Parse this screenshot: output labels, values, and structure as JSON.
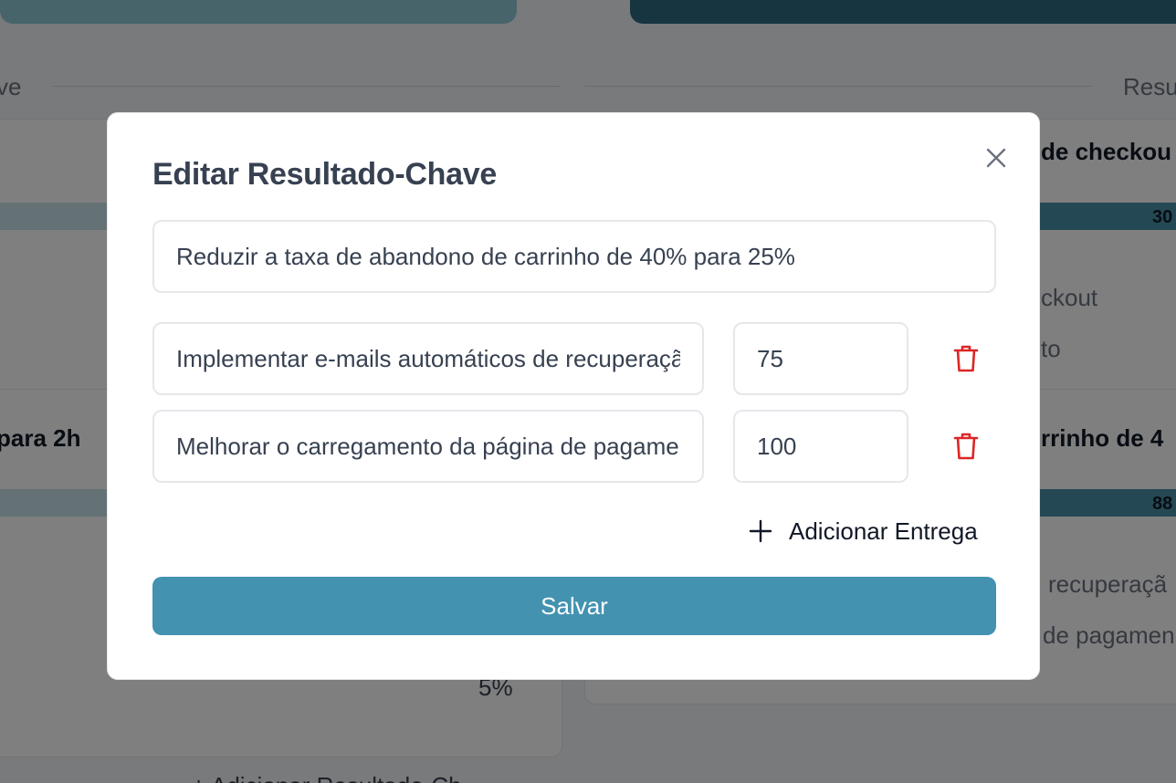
{
  "background": {
    "left_header_fragment": "ve",
    "right_header_fragment": "Resu",
    "left_kr_title_fragment": "para 2h",
    "left_pct_fragment": "5%",
    "left_add_fragment": "+ Adicionar Resultado-Ch",
    "right_kr1_title_fragment": "de checkou",
    "right_kr1_pct_fragment": "30",
    "right_kr1_item1_fragment": "ckout",
    "right_kr1_item2_fragment": "to",
    "right_kr2_title_fragment": "rrinho de 4",
    "right_kr2_pct_fragment": "88",
    "right_kr2_item1_fragment": "recuperaçã",
    "right_kr2_item2_fragment": "de pagamen"
  },
  "modal": {
    "title": "Editar Resultado-Chave",
    "key_result_value": "Reduzir a taxa de abandono de carrinho de 40% para 25%",
    "deliverables": [
      {
        "name": "Implementar e-mails automáticos de recuperação",
        "progress": "75"
      },
      {
        "name": "Melhorar o carregamento da página de pagamento",
        "progress": "100"
      }
    ],
    "add_label": "Adicionar Entrega",
    "save_label": "Salvar"
  },
  "colors": {
    "accent": "#4292b0",
    "delete": "#dc2626",
    "overlay": "rgba(0,0,0,0.5)"
  },
  "icons": {
    "close": "close-icon",
    "delete": "trash-icon",
    "add": "plus-icon"
  }
}
